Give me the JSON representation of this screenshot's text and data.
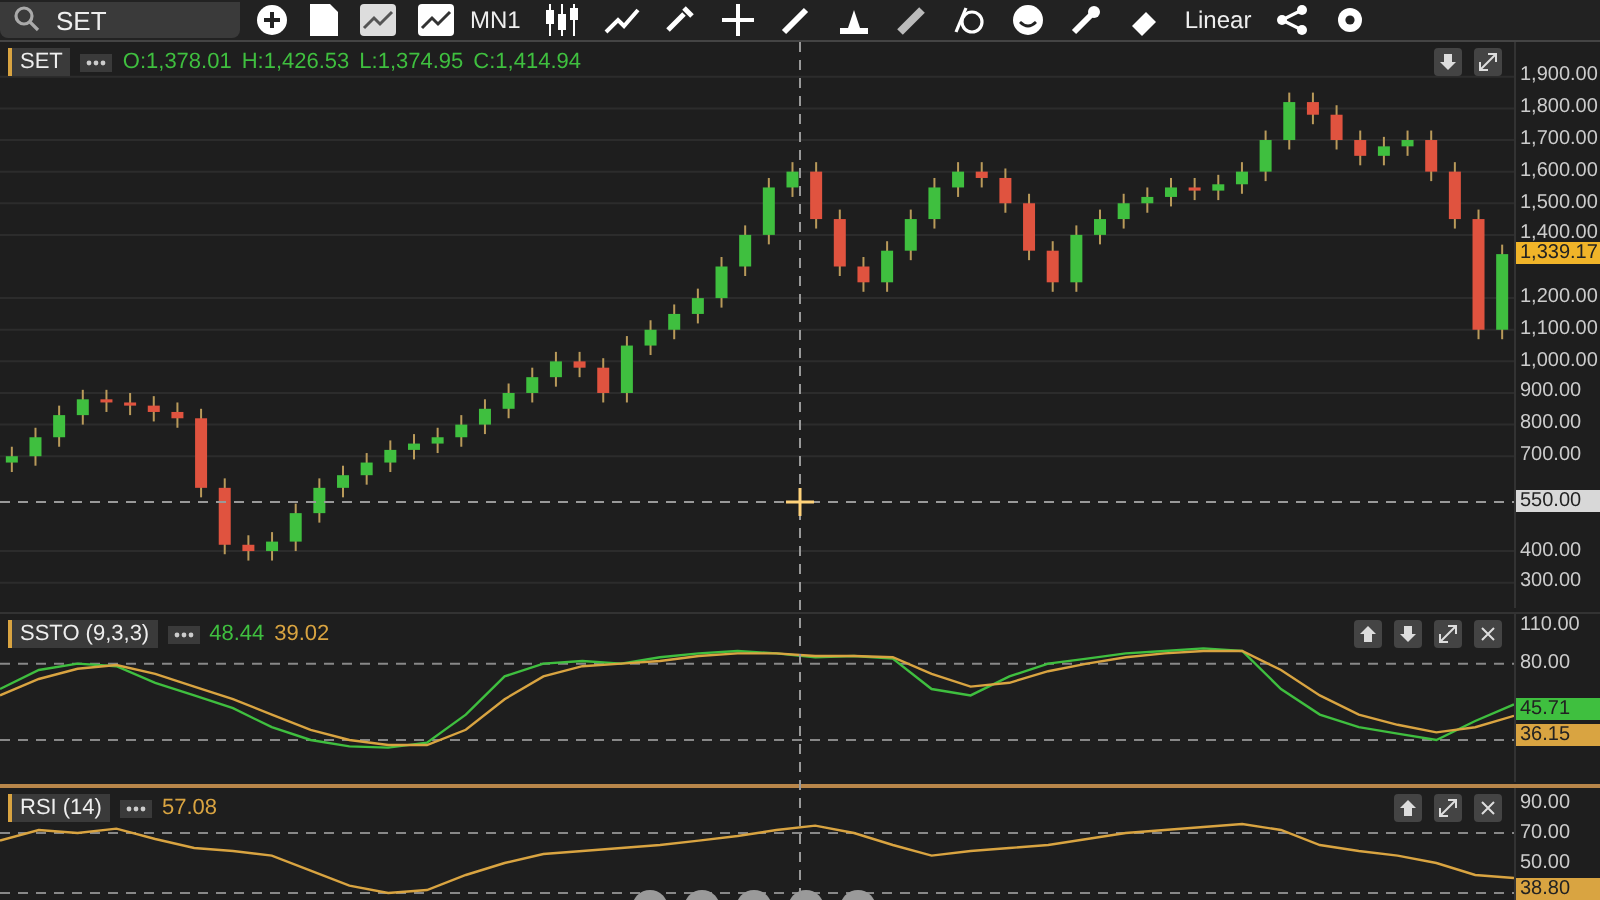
{
  "toolbar": {
    "search": {
      "value": "SET"
    },
    "period": "MN1",
    "scale": "Linear"
  },
  "main": {
    "symbol": "SET",
    "open": "O:1,378.01",
    "high": "H:1,426.53",
    "low": "L:1,374.95",
    "close": "C:1,414.94",
    "price_marker": "1,339.17",
    "crosshair_marker": "550.00",
    "chart_data": {
      "type": "candlestick",
      "ylim": [
        220,
        2010
      ],
      "grid": true,
      "yticks": [
        {
          "value": 300,
          "label": "300.00"
        },
        {
          "value": 400,
          "label": "400.00"
        },
        {
          "value": 700,
          "label": "700.00"
        },
        {
          "value": 800,
          "label": "800.00"
        },
        {
          "value": 900,
          "label": "900.00"
        },
        {
          "value": 1000,
          "label": "1,000.00"
        },
        {
          "value": 1100,
          "label": "1,100.00"
        },
        {
          "value": 1200,
          "label": "1,200.00"
        },
        {
          "value": 1400,
          "label": "1,400.00"
        },
        {
          "value": 1500,
          "label": "1,500.00"
        },
        {
          "value": 1600,
          "label": "1,600.00"
        },
        {
          "value": 1700,
          "label": "1,700.00"
        },
        {
          "value": 1800,
          "label": "1,800.00"
        },
        {
          "value": 1900,
          "label": "1,900.00"
        }
      ],
      "ohlc": [
        [
          680,
          730,
          650,
          700
        ],
        [
          700,
          790,
          670,
          760
        ],
        [
          760,
          860,
          730,
          830
        ],
        [
          830,
          910,
          800,
          880
        ],
        [
          880,
          910,
          840,
          870
        ],
        [
          870,
          900,
          830,
          860
        ],
        [
          860,
          890,
          810,
          840
        ],
        [
          840,
          870,
          790,
          820
        ],
        [
          820,
          850,
          570,
          600
        ],
        [
          600,
          630,
          390,
          420
        ],
        [
          420,
          450,
          370,
          400
        ],
        [
          400,
          460,
          370,
          430
        ],
        [
          430,
          550,
          400,
          520
        ],
        [
          520,
          630,
          490,
          600
        ],
        [
          600,
          670,
          570,
          640
        ],
        [
          640,
          710,
          610,
          680
        ],
        [
          680,
          750,
          650,
          720
        ],
        [
          720,
          770,
          690,
          740
        ],
        [
          740,
          790,
          710,
          760
        ],
        [
          760,
          830,
          730,
          800
        ],
        [
          800,
          880,
          770,
          850
        ],
        [
          850,
          930,
          820,
          900
        ],
        [
          900,
          980,
          870,
          950
        ],
        [
          950,
          1030,
          920,
          1000
        ],
        [
          1000,
          1030,
          950,
          980
        ],
        [
          980,
          1010,
          870,
          900
        ],
        [
          900,
          1080,
          870,
          1050
        ],
        [
          1050,
          1130,
          1020,
          1100
        ],
        [
          1100,
          1180,
          1070,
          1150
        ],
        [
          1150,
          1230,
          1120,
          1200
        ],
        [
          1200,
          1330,
          1170,
          1300
        ],
        [
          1300,
          1430,
          1270,
          1400
        ],
        [
          1400,
          1580,
          1370,
          1550
        ],
        [
          1550,
          1630,
          1520,
          1600
        ],
        [
          1600,
          1630,
          1420,
          1450
        ],
        [
          1450,
          1480,
          1270,
          1300
        ],
        [
          1300,
          1330,
          1220,
          1250
        ],
        [
          1250,
          1380,
          1220,
          1350
        ],
        [
          1350,
          1480,
          1320,
          1450
        ],
        [
          1450,
          1580,
          1420,
          1550
        ],
        [
          1550,
          1630,
          1520,
          1600
        ],
        [
          1600,
          1630,
          1550,
          1580
        ],
        [
          1580,
          1610,
          1470,
          1500
        ],
        [
          1500,
          1530,
          1320,
          1350
        ],
        [
          1350,
          1380,
          1220,
          1250
        ],
        [
          1250,
          1430,
          1220,
          1400
        ],
        [
          1400,
          1480,
          1370,
          1450
        ],
        [
          1450,
          1530,
          1420,
          1500
        ],
        [
          1500,
          1550,
          1470,
          1520
        ],
        [
          1520,
          1580,
          1490,
          1550
        ],
        [
          1550,
          1580,
          1510,
          1540
        ],
        [
          1540,
          1590,
          1510,
          1560
        ],
        [
          1560,
          1630,
          1530,
          1600
        ],
        [
          1600,
          1730,
          1570,
          1700
        ],
        [
          1700,
          1850,
          1670,
          1820
        ],
        [
          1820,
          1850,
          1750,
          1780
        ],
        [
          1780,
          1810,
          1670,
          1700
        ],
        [
          1700,
          1730,
          1620,
          1650
        ],
        [
          1650,
          1710,
          1620,
          1680
        ],
        [
          1680,
          1730,
          1650,
          1700
        ],
        [
          1700,
          1730,
          1570,
          1600
        ],
        [
          1600,
          1630,
          1420,
          1450
        ],
        [
          1450,
          1480,
          1070,
          1100
        ],
        [
          1100,
          1369.17,
          1070,
          1339.17
        ]
      ]
    }
  },
  "ssto": {
    "title": "SSTO (9,3,3)",
    "k_value": "48.44",
    "d_value": "39.02",
    "k_marker": "45.71",
    "d_marker": "36.15",
    "chart_data": {
      "type": "line",
      "ylim": [
        -13,
        119
      ],
      "yticks": [
        {
          "value": 110,
          "label": "110.00"
        },
        {
          "value": 80,
          "label": "80.00"
        }
      ],
      "series": [
        {
          "color": "#3fbf3f",
          "values": [
            60,
            75,
            80,
            78,
            65,
            55,
            45,
            30,
            20,
            15,
            14,
            18,
            40,
            70,
            80,
            82,
            80,
            85,
            88,
            90,
            88,
            85,
            86,
            84,
            60,
            55,
            70,
            80,
            84,
            88,
            90,
            92,
            90,
            60,
            40,
            30,
            25,
            20,
            35,
            48
          ]
        },
        {
          "color": "#d9a441",
          "values": [
            55,
            68,
            76,
            79,
            72,
            62,
            52,
            40,
            28,
            20,
            16,
            16,
            28,
            52,
            70,
            78,
            80,
            82,
            86,
            88,
            88,
            86,
            86,
            85,
            72,
            62,
            65,
            74,
            80,
            85,
            88,
            90,
            90,
            75,
            55,
            40,
            32,
            26,
            30,
            39
          ]
        }
      ]
    }
  },
  "rsi": {
    "title": "RSI (14)",
    "value": "57.08",
    "marker": "38.80",
    "chart_data": {
      "type": "line",
      "ylim": [
        20,
        100
      ],
      "yticks": [
        {
          "value": 90,
          "label": "90.00"
        },
        {
          "value": 70,
          "label": "70.00"
        },
        {
          "value": 50,
          "label": "50.00"
        }
      ],
      "series": [
        {
          "color": "#d9a441",
          "values": [
            65,
            72,
            70,
            73,
            66,
            60,
            58,
            55,
            45,
            35,
            30,
            32,
            42,
            50,
            56,
            58,
            60,
            62,
            65,
            68,
            72,
            75,
            70,
            62,
            55,
            58,
            60,
            62,
            66,
            70,
            72,
            74,
            76,
            72,
            62,
            58,
            55,
            50,
            42,
            40
          ]
        }
      ]
    }
  }
}
